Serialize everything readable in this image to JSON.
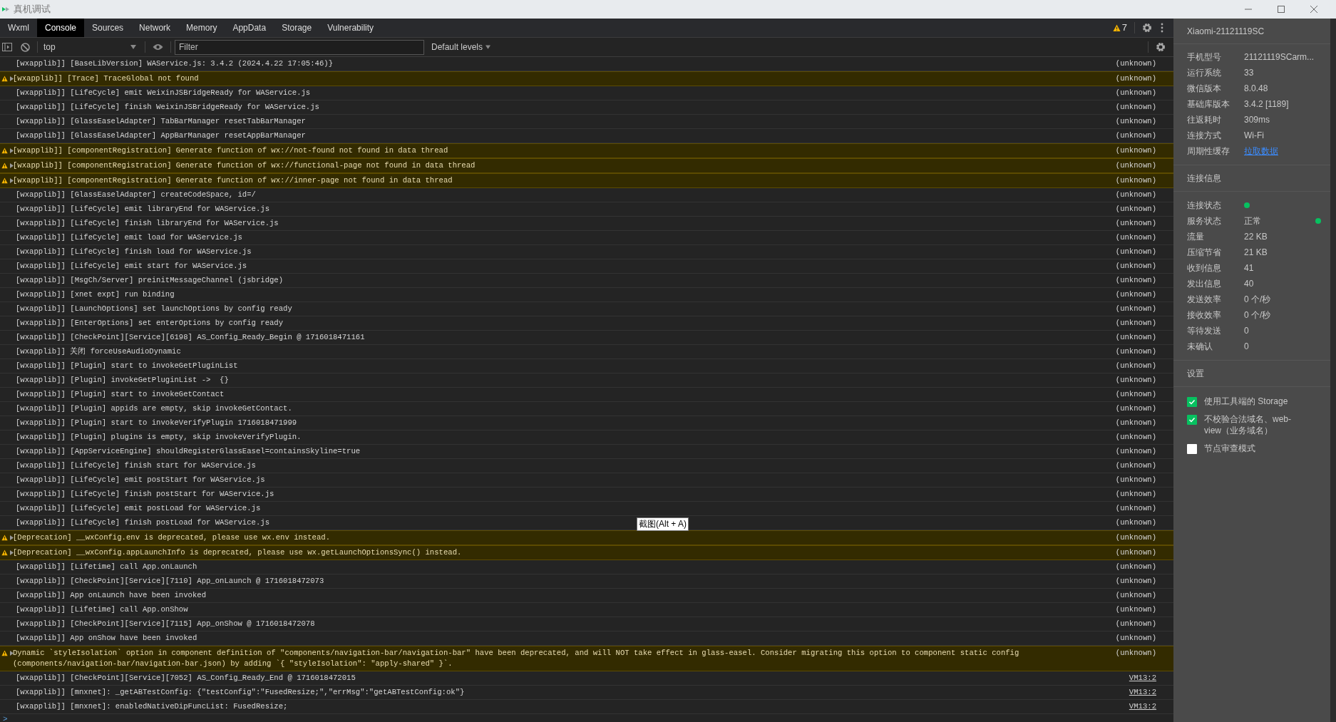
{
  "window": {
    "title": "真机调试"
  },
  "tabs": [
    {
      "label": "Wxml",
      "selected": false
    },
    {
      "label": "Console",
      "selected": true
    },
    {
      "label": "Sources",
      "selected": false
    },
    {
      "label": "Network",
      "selected": false
    },
    {
      "label": "Memory",
      "selected": false
    },
    {
      "label": "AppData",
      "selected": false
    },
    {
      "label": "Storage",
      "selected": false
    },
    {
      "label": "Vulnerability",
      "selected": false
    }
  ],
  "warning_count": "7",
  "toolbar": {
    "context": "top",
    "filter_placeholder": "Filter",
    "levels": "Default levels"
  },
  "log": [
    {
      "kind": "info",
      "text": "[wxapplib]] [BaseLibVersion] WAService.js: 3.4.2 (2024.4.22 17:05:46)}",
      "source": "(unknown)",
      "link": false
    },
    {
      "kind": "warning",
      "text": "[wxapplib]] [Trace] TraceGlobal not found",
      "source": "(unknown)",
      "link": false
    },
    {
      "kind": "info",
      "text": "[wxapplib]] [LifeCycle] emit WeixinJSBridgeReady for WAService.js",
      "source": "(unknown)",
      "link": false
    },
    {
      "kind": "info",
      "text": "[wxapplib]] [LifeCycle] finish WeixinJSBridgeReady for WAService.js",
      "source": "(unknown)",
      "link": false
    },
    {
      "kind": "info",
      "text": "[wxapplib]] [GlassEaselAdapter] TabBarManager resetTabBarManager",
      "source": "(unknown)",
      "link": false
    },
    {
      "kind": "info",
      "text": "[wxapplib]] [GlassEaselAdapter] AppBarManager resetAppBarManager",
      "source": "(unknown)",
      "link": false
    },
    {
      "kind": "warning",
      "text": "[wxapplib]] [componentRegistration] Generate function of wx://not-found not found in data thread",
      "source": "(unknown)",
      "link": false
    },
    {
      "kind": "warning",
      "text": "[wxapplib]] [componentRegistration] Generate function of wx://functional-page not found in data thread",
      "source": "(unknown)",
      "link": false
    },
    {
      "kind": "warning",
      "text": "[wxapplib]] [componentRegistration] Generate function of wx://inner-page not found in data thread",
      "source": "(unknown)",
      "link": false
    },
    {
      "kind": "info",
      "text": "[wxapplib]] [GlassEaselAdapter] createCodeSpace, id=/",
      "source": "(unknown)",
      "link": false
    },
    {
      "kind": "info",
      "text": "[wxapplib]] [LifeCycle] emit libraryEnd for WAService.js",
      "source": "(unknown)",
      "link": false
    },
    {
      "kind": "info",
      "text": "[wxapplib]] [LifeCycle] finish libraryEnd for WAService.js",
      "source": "(unknown)",
      "link": false
    },
    {
      "kind": "info",
      "text": "[wxapplib]] [LifeCycle] emit load for WAService.js",
      "source": "(unknown)",
      "link": false
    },
    {
      "kind": "info",
      "text": "[wxapplib]] [LifeCycle] finish load for WAService.js",
      "source": "(unknown)",
      "link": false
    },
    {
      "kind": "info",
      "text": "[wxapplib]] [LifeCycle] emit start for WAService.js",
      "source": "(unknown)",
      "link": false
    },
    {
      "kind": "info",
      "text": "[wxapplib]] [MsgCh/Server] preinitMessageChannel (jsbridge)",
      "source": "(unknown)",
      "link": false
    },
    {
      "kind": "info",
      "text": "[wxapplib]] [xnet expt] run binding",
      "source": "(unknown)",
      "link": false
    },
    {
      "kind": "info",
      "text": "[wxapplib]] [LaunchOptions] set launchOptions by config ready",
      "source": "(unknown)",
      "link": false
    },
    {
      "kind": "info",
      "text": "[wxapplib]] [EnterOptions] set enterOptions by config ready",
      "source": "(unknown)",
      "link": false
    },
    {
      "kind": "info",
      "text": "[wxapplib]] [CheckPoint][Service][6198] AS_Config_Ready_Begin @ 1716018471161",
      "source": "(unknown)",
      "link": false
    },
    {
      "kind": "info",
      "text": "[wxapplib]] 关闭 forceUseAudioDynamic",
      "source": "(unknown)",
      "link": false
    },
    {
      "kind": "info",
      "text": "[wxapplib]] [Plugin] start to invokeGetPluginList",
      "source": "(unknown)",
      "link": false
    },
    {
      "kind": "info",
      "text": "[wxapplib]] [Plugin] invokeGetPluginList ->  {}",
      "source": "(unknown)",
      "link": false
    },
    {
      "kind": "info",
      "text": "[wxapplib]] [Plugin] start to invokeGetContact",
      "source": "(unknown)",
      "link": false
    },
    {
      "kind": "info",
      "text": "[wxapplib]] [Plugin] appids are empty, skip invokeGetContact.",
      "source": "(unknown)",
      "link": false
    },
    {
      "kind": "info",
      "text": "[wxapplib]] [Plugin] start to invokeVerifyPlugin 1716018471999",
      "source": "(unknown)",
      "link": false
    },
    {
      "kind": "info",
      "text": "[wxapplib]] [Plugin] plugins is empty, skip invokeVerifyPlugin.",
      "source": "(unknown)",
      "link": false
    },
    {
      "kind": "info",
      "text": "[wxapplib]] [AppServiceEngine] shouldRegisterGlassEasel=containsSkyline=true",
      "source": "(unknown)",
      "link": false
    },
    {
      "kind": "info",
      "text": "[wxapplib]] [LifeCycle] finish start for WAService.js",
      "source": "(unknown)",
      "link": false
    },
    {
      "kind": "info",
      "text": "[wxapplib]] [LifeCycle] emit postStart for WAService.js",
      "source": "(unknown)",
      "link": false
    },
    {
      "kind": "info",
      "text": "[wxapplib]] [LifeCycle] finish postStart for WAService.js",
      "source": "(unknown)",
      "link": false
    },
    {
      "kind": "info",
      "text": "[wxapplib]] [LifeCycle] emit postLoad for WAService.js",
      "source": "(unknown)",
      "link": false
    },
    {
      "kind": "info",
      "text": "[wxapplib]] [LifeCycle] finish postLoad for WAService.js",
      "source": "(unknown)",
      "link": false
    },
    {
      "kind": "warning",
      "text": "[Deprecation] __wxConfig.env is deprecated, please use wx.env instead.",
      "source": "(unknown)",
      "link": false
    },
    {
      "kind": "warning",
      "text": "[Deprecation] __wxConfig.appLaunchInfo is deprecated, please use wx.getLaunchOptionsSync() instead.",
      "source": "(unknown)",
      "link": false
    },
    {
      "kind": "info",
      "text": "[wxapplib]] [Lifetime] call App.onLaunch",
      "source": "(unknown)",
      "link": false
    },
    {
      "kind": "info",
      "text": "[wxapplib]] [CheckPoint][Service][7110] App_onLaunch @ 1716018472073",
      "source": "(unknown)",
      "link": false
    },
    {
      "kind": "info",
      "text": "[wxapplib]] App onLaunch have been invoked",
      "source": "(unknown)",
      "link": false
    },
    {
      "kind": "info",
      "text": "[wxapplib]] [Lifetime] call App.onShow",
      "source": "(unknown)",
      "link": false
    },
    {
      "kind": "info",
      "text": "[wxapplib]] [CheckPoint][Service][7115] App_onShow @ 1716018472078",
      "source": "(unknown)",
      "link": false
    },
    {
      "kind": "info",
      "text": "[wxapplib]] App onShow have been invoked",
      "source": "(unknown)",
      "link": false
    },
    {
      "kind": "warning",
      "text": "Dynamic `styleIsolation` option in component definition of \"components/navigation-bar/navigation-bar\" have been deprecated, and will NOT take effect in glass-easel. Consider migrating this option to component static config (components/navigation-bar/navigation-bar.json) by adding `{ \"styleIsolation\": \"apply-shared\" }`.",
      "source": "(unknown)",
      "link": false
    },
    {
      "kind": "info",
      "text": "[wxapplib]] [CheckPoint][Service][7052] AS_Config_Ready_End @ 1716018472015",
      "source": "VM13:2",
      "link": true
    },
    {
      "kind": "info",
      "text": "[wxapplib]] [mnxnet]: _getABTestConfig: {\"testConfig\":\"FusedResize;\",\"errMsg\":\"getABTestConfig:ok\"}",
      "source": "VM13:2",
      "link": true
    },
    {
      "kind": "info",
      "text": "[wxapplib]] [mnxnet]: enabledNativeDipFuncList: FusedResize;",
      "source": "VM13:2",
      "link": true
    }
  ],
  "prompt": ">",
  "tooltip": "截图(Alt + A)",
  "panel": {
    "device": "Xiaomi-21121119SC",
    "info": [
      {
        "label": "手机型号",
        "value": "21121119SCarm...",
        "link": false
      },
      {
        "label": "运行系统",
        "value": "33",
        "link": false
      },
      {
        "label": "微信版本",
        "value": "8.0.48",
        "link": false
      },
      {
        "label": "基础库版本",
        "value": "3.4.2 [1189]",
        "link": false
      },
      {
        "label": "往返耗时",
        "value": "309ms",
        "link": false
      },
      {
        "label": "连接方式",
        "value": "Wi-Fi",
        "link": false
      },
      {
        "label": "周期性缓存",
        "value": "拉取数据",
        "link": true
      }
    ],
    "connection_title": "连接信息",
    "connection": [
      {
        "kind": "dot",
        "label": "连接状态",
        "ok": true
      },
      {
        "kind": "value_dot",
        "label": "服务状态",
        "value": "正常",
        "ok": true
      },
      {
        "kind": "value",
        "label": "流量",
        "value": "22 KB"
      },
      {
        "kind": "value",
        "label": "压缩节省",
        "value": "21 KB"
      },
      {
        "kind": "value",
        "label": "收到信息",
        "value": "41"
      },
      {
        "kind": "value",
        "label": "发出信息",
        "value": "40"
      },
      {
        "kind": "value",
        "label": "发送效率",
        "value": "0 个/秒"
      },
      {
        "kind": "value",
        "label": "接收效率",
        "value": "0 个/秒"
      },
      {
        "kind": "value",
        "label": "等待发送",
        "value": "0"
      },
      {
        "kind": "value",
        "label": "未确认",
        "value": "0"
      }
    ],
    "settings_title": "设置",
    "settings": [
      {
        "label": "使用工具端的 Storage",
        "checked": true
      },
      {
        "label": "不校验合法域名、web-view（业务域名）",
        "checked": true
      },
      {
        "label": "节点审查模式",
        "checked": false
      }
    ]
  }
}
